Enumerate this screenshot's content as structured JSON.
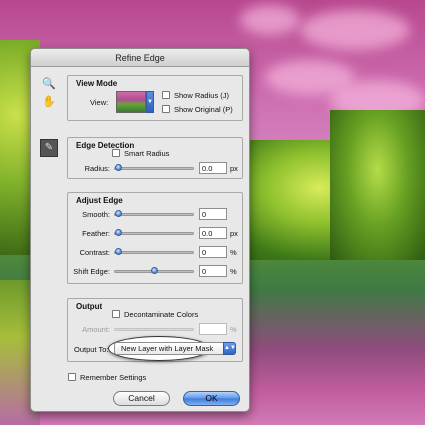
{
  "dialog": {
    "title": "Refine Edge"
  },
  "tools": {
    "zoom_icon": "magnifier-icon",
    "hand_icon": "hand-icon",
    "brush_icon": "refine-radius-brush-icon"
  },
  "view_mode": {
    "title": "View Mode",
    "view_label": "View:",
    "show_radius": "Show Radius (J)",
    "show_original": "Show Original (P)"
  },
  "edge_detection": {
    "title": "Edge Detection",
    "smart_radius": "Smart Radius",
    "radius_label": "Radius:",
    "radius_value": "0.0",
    "radius_unit": "px",
    "radius_level": 0
  },
  "adjust_edge": {
    "title": "Adjust Edge",
    "smooth_label": "Smooth:",
    "smooth_value": "0",
    "smooth_level": 0,
    "feather_label": "Feather:",
    "feather_value": "0.0",
    "feather_unit": "px",
    "feather_level": 0,
    "contrast_label": "Contrast:",
    "contrast_value": "0",
    "contrast_unit": "%",
    "contrast_level": 0,
    "shift_label": "Shift Edge:",
    "shift_value": "0",
    "shift_unit": "%",
    "shift_level": 0.5
  },
  "output": {
    "title": "Output",
    "decontaminate": "Decontaminate Colors",
    "amount_label": "Amount:",
    "amount_unit": "%",
    "output_to_label": "Output To:",
    "output_to_value": "New Layer with Layer Mask"
  },
  "footer": {
    "remember": "Remember Settings",
    "cancel": "Cancel",
    "ok": "OK"
  }
}
